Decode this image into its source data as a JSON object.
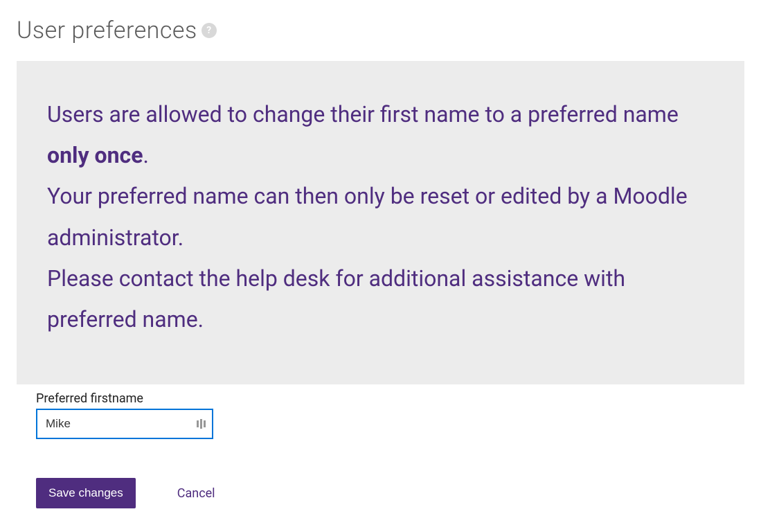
{
  "page": {
    "title": "User preferences"
  },
  "notice": {
    "line1_pre": "Users are allowed to change their first name to a preferred name ",
    "line1_bold": "only once",
    "line1_post": ".",
    "line2": "Your preferred name can then only be reset or edited by a Moodle administrator.",
    "line3": "Please contact the help desk for additional assistance with preferred name."
  },
  "form": {
    "preferred_firstname_label": "Preferred firstname",
    "preferred_firstname_value": "Mike"
  },
  "actions": {
    "save_label": "Save changes",
    "cancel_label": "Cancel"
  }
}
